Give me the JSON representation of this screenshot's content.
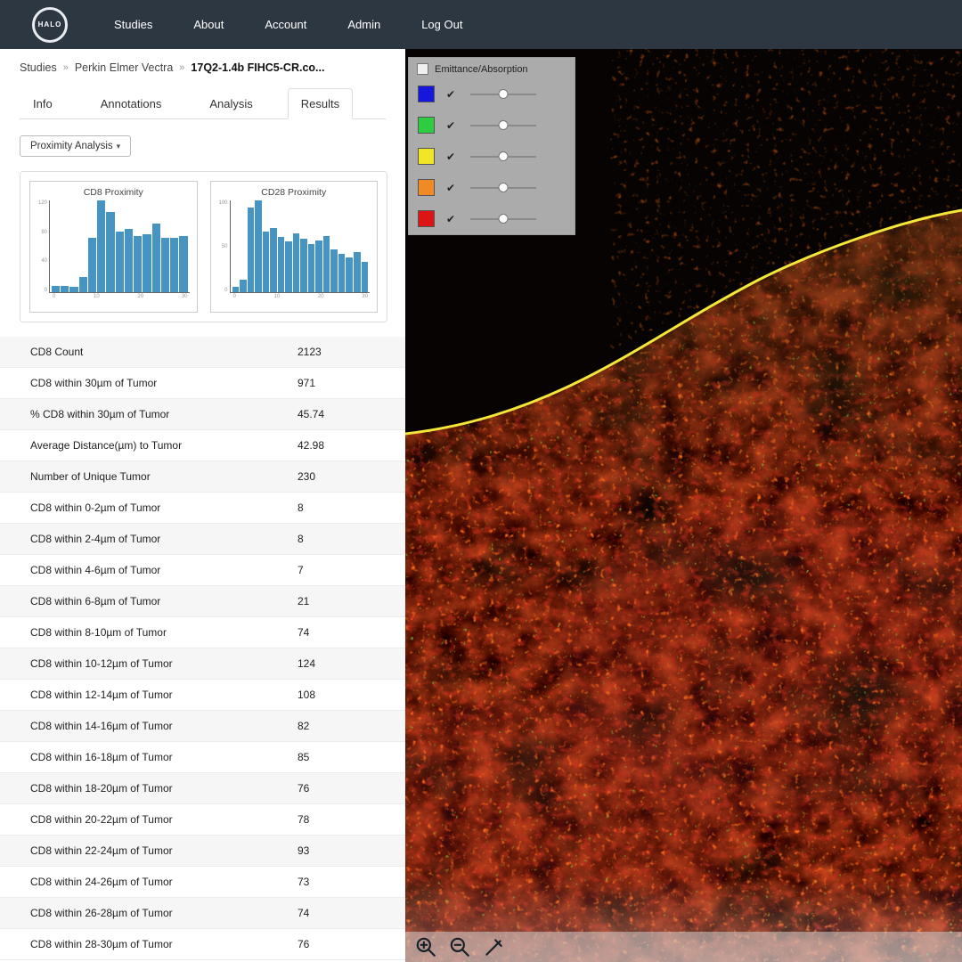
{
  "nav": {
    "logo_text": "HALO",
    "items": [
      "Studies",
      "About",
      "Account",
      "Admin",
      "Log Out"
    ]
  },
  "breadcrumb": {
    "separator": "»",
    "items": [
      "Studies",
      "Perkin Elmer Vectra",
      "17Q2-1.4b FIHC5-CR.co..."
    ]
  },
  "tabs": [
    {
      "label": "Info",
      "active": false
    },
    {
      "label": "Annotations",
      "active": false
    },
    {
      "label": "Analysis",
      "active": false
    },
    {
      "label": "Results",
      "active": true
    }
  ],
  "analysis_dropdown": {
    "label": "Proximity Analysis",
    "caret": "▾"
  },
  "chart_data": [
    {
      "type": "bar",
      "title": "CD8 Proximity",
      "xlabel": "",
      "ylabel": "",
      "xlim": [
        0,
        30
      ],
      "x_ticks": [
        "0",
        "10",
        "20",
        "30"
      ],
      "y_ticks": [
        "120",
        "80",
        "40",
        "0"
      ],
      "values": [
        8,
        8,
        7,
        21,
        74,
        124,
        108,
        82,
        85,
        76,
        78,
        93,
        73,
        74,
        76
      ],
      "color": "#4694c2"
    },
    {
      "type": "bar",
      "title": "CD28 Proximity",
      "xlabel": "",
      "ylabel": "",
      "xlim": [
        0,
        30
      ],
      "x_ticks": [
        "0",
        "10",
        "20",
        "30"
      ],
      "y_ticks": [
        "100",
        "50",
        "0"
      ],
      "values": [
        6,
        14,
        92,
        100,
        66,
        70,
        60,
        55,
        64,
        58,
        52,
        56,
        61,
        47,
        42,
        38,
        44,
        33
      ],
      "color": "#4694c2"
    }
  ],
  "results_table": {
    "rows": [
      {
        "label": "CD8 Count",
        "value": "2123"
      },
      {
        "label": "CD8 within 30µm of Tumor",
        "value": "971"
      },
      {
        "label": "% CD8 within 30µm of Tumor",
        "value": "45.74"
      },
      {
        "label": "Average Distance(µm) to Tumor",
        "value": "42.98"
      },
      {
        "label": "Number of Unique Tumor",
        "value": "230"
      },
      {
        "label": "CD8 within 0-2µm of Tumor",
        "value": "8"
      },
      {
        "label": "CD8 within 2-4µm of Tumor",
        "value": "8"
      },
      {
        "label": "CD8 within 4-6µm of Tumor",
        "value": "7"
      },
      {
        "label": "CD8 within 6-8µm of Tumor",
        "value": "21"
      },
      {
        "label": "CD8 within 8-10µm of Tumor",
        "value": "74"
      },
      {
        "label": "CD8 within 10-12µm of Tumor",
        "value": "124"
      },
      {
        "label": "CD8 within 12-14µm of Tumor",
        "value": "108"
      },
      {
        "label": "CD8 within 14-16µm of Tumor",
        "value": "82"
      },
      {
        "label": "CD8 within 16-18µm of Tumor",
        "value": "85"
      },
      {
        "label": "CD8 within 18-20µm of Tumor",
        "value": "76"
      },
      {
        "label": "CD8 within 20-22µm of Tumor",
        "value": "78"
      },
      {
        "label": "CD8 within 22-24µm of Tumor",
        "value": "93"
      },
      {
        "label": "CD8 within 24-26µm of Tumor",
        "value": "73"
      },
      {
        "label": "CD8 within 26-28µm of Tumor",
        "value": "74"
      },
      {
        "label": "CD8 within 28-30µm of Tumor",
        "value": "76"
      }
    ]
  },
  "channel_panel": {
    "title": "Emittance/Absorption",
    "check_glyph": "✔",
    "channels": [
      {
        "name": "blue",
        "color": "#1616dd",
        "checked": true,
        "slider": 50
      },
      {
        "name": "green",
        "color": "#2ecc40",
        "checked": true,
        "slider": 50
      },
      {
        "name": "yellow",
        "color": "#f0e626",
        "checked": true,
        "slider": 50
      },
      {
        "name": "orange",
        "color": "#ef8a24",
        "checked": true,
        "slider": 50
      },
      {
        "name": "red",
        "color": "#dd1414",
        "checked": true,
        "slider": 50
      }
    ]
  },
  "viewer": {
    "annotation_color": "#f3e73a",
    "tools": [
      "zoom-in",
      "zoom-out",
      "annotation-pen"
    ]
  }
}
